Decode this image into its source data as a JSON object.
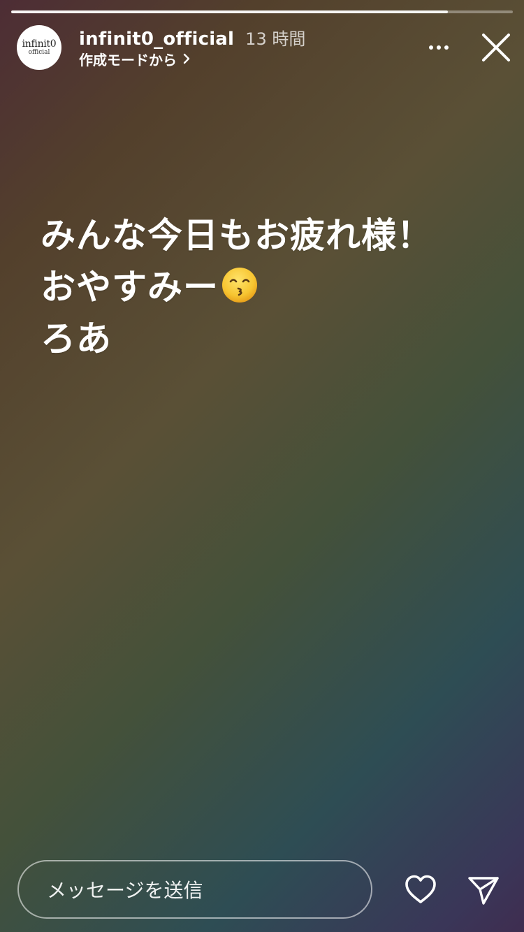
{
  "story": {
    "progress_percent": 87,
    "account": {
      "username": "infinit0_official",
      "time_ago": "13 時間",
      "mode_label": "作成モードから",
      "avatar_text_line1": "infinit0",
      "avatar_text_line2": "official"
    },
    "text_lines": [
      "みんな今日もお疲れ様！",
      "おやすみー",
      "ろあ"
    ],
    "emoji": "kissing-face-with-smiling-eyes",
    "footer": {
      "message_placeholder": "メッセージを送信"
    },
    "icons": {
      "more": "more-horizontal-icon",
      "close": "close-icon",
      "heart": "heart-icon",
      "send": "send-icon",
      "chevron": "chevron-right-icon"
    }
  }
}
